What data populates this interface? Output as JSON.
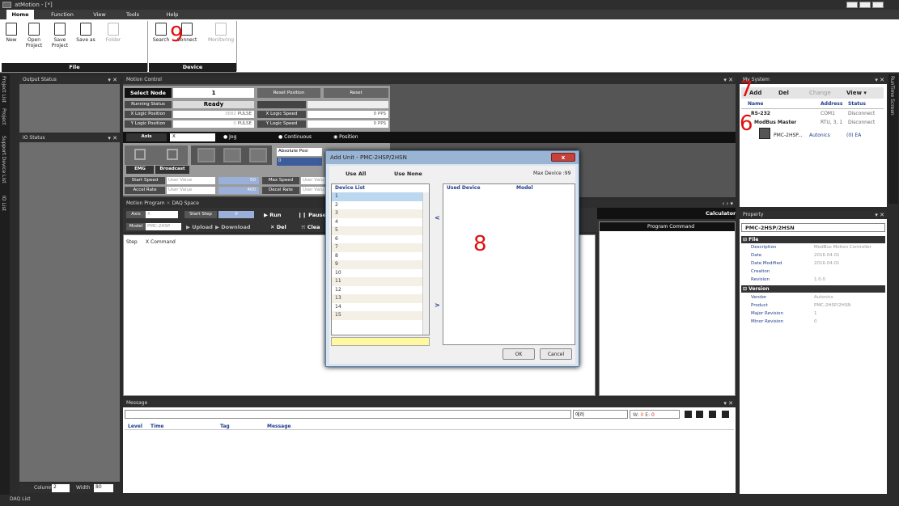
{
  "app": {
    "title": "atMotion - [*]"
  },
  "menu": {
    "tabs": [
      "Home",
      "Function",
      "View",
      "Tools",
      "Help"
    ]
  },
  "ribbon": {
    "file_group": "File",
    "device_group": "Device",
    "buttons": {
      "new": "New",
      "open": "Open\nProject",
      "save": "Save\nProject",
      "saveas": "Save as",
      "folder": "Folder",
      "search": "Search",
      "connect": "Connect",
      "monitoring": "Monitoring"
    }
  },
  "annotations": {
    "six": "6",
    "seven": "7",
    "eight": "8",
    "nine": "9"
  },
  "left_tabs": {
    "project_list": "Project List",
    "project": "Project",
    "support": "Support Device List",
    "io_list": "IO List",
    "daq_list": "DAQ List"
  },
  "output_status": {
    "title": "Output Status"
  },
  "io_status": {
    "title": "IO Status"
  },
  "column_width": {
    "column_label": "Column",
    "column_value": "2",
    "width_label": "Width",
    "width_value": "80"
  },
  "motion_control": {
    "title": "Motion Control",
    "select_node": "Select Node",
    "node": "1",
    "reset_position": "Reset Position",
    "reset": "Reset",
    "running_status": "Running Status",
    "status_value": "Ready",
    "x_pos_label": "X Logic Position",
    "x_pos": "3682",
    "pulse1": "PULSE",
    "x_speed_label": "X Logic Speed",
    "x_speed": "0",
    "pps1": "PPS",
    "y_pos_label": "Y Logic Position",
    "y_pos": "0",
    "pulse2": "PULSE",
    "y_speed_label": "Y Logic Speed",
    "y_speed": "0",
    "pps2": "PPS",
    "axis_label": "Axis",
    "axis_value": "X",
    "jog": "Jog",
    "continuous": "Continuous",
    "position": "Position",
    "abs_pos": "Absolute Posi",
    "abs_val": "0",
    "emg": "EMG",
    "broadcast": "Broadcast",
    "start_speed": "Start Speed",
    "max_speed": "Max Speed",
    "accel_rate": "Accel Rate",
    "decel_rate": "Decel Rate",
    "user_value": "User Value",
    "start_val": "50",
    "accel_val": "400",
    "max_val": "User Valu",
    "decel_val": "User Valu"
  },
  "motion_program": {
    "tabs": [
      "Motion Program",
      "DAQ Space"
    ],
    "axis": "Axis",
    "axis_val": "X",
    "start_step": "Start Step",
    "start_val": "0",
    "run": "Run",
    "pause": "Pause",
    "model": "Model",
    "model_val": "PMC-2HSP",
    "upload": "Upload",
    "download": "Download",
    "del": "Del",
    "clear": "Clea",
    "col_step": "Step",
    "col_xcmd": "X Command",
    "program_command": "Program Command",
    "calculator": "Calculator"
  },
  "message": {
    "title": "Message",
    "filter": "에러",
    "w_label": "W:",
    "w_val": "0",
    "e_label": "E:",
    "e_val": "0",
    "cols": [
      "Level",
      "Time",
      "Tag",
      "Message"
    ]
  },
  "my_system": {
    "title": "My System",
    "add": "Add",
    "del": "Del",
    "change": "Change",
    "view": "View",
    "col_name": "Name",
    "col_address": "Address",
    "col_status": "Status",
    "rows": [
      {
        "name": "RS-232",
        "address": "COM1",
        "status": "Disconnect"
      },
      {
        "name": "ModBus Master",
        "address": "RTU, 3, 1",
        "status": "Disconnect"
      },
      {
        "name": "PMC-2HSP...",
        "address": "Autonics",
        "status": "(0) EA"
      }
    ],
    "runtime": "RunTime Screen"
  },
  "property": {
    "title": "Property",
    "header": "PMC-2HSP/2HSN",
    "file_section": "File",
    "file": [
      [
        "Description",
        "ModBus Motion Controller"
      ],
      [
        "Date",
        "2016.04.01"
      ],
      [
        "Date Modified",
        "2016.04.01"
      ],
      [
        "Creation",
        ""
      ],
      [
        "Revision",
        "1.0.0"
      ]
    ],
    "version_section": "Version",
    "version": [
      [
        "Vendor",
        "Autonics"
      ],
      [
        "Product",
        "PMC-2HSP/2HSN"
      ],
      [
        "Major Revision",
        "1"
      ],
      [
        "Minor Revision",
        "0"
      ]
    ]
  },
  "dialog": {
    "title": "Add Unit - PMC-2HSP/2HSN",
    "use_all": "Use All",
    "use_none": "Use None",
    "max_device": "Max Device :99",
    "device_list": "Device List",
    "used_device": "Used Device",
    "model": "Model",
    "devices": [
      "1",
      "2",
      "3",
      "4",
      "5",
      "6",
      "7",
      "8",
      "9",
      "10",
      "11",
      "12",
      "13",
      "14",
      "15"
    ],
    "left_arrow": "<",
    "right_arrow": ">",
    "ok": "OK",
    "cancel": "Cancel",
    "close": "x"
  }
}
